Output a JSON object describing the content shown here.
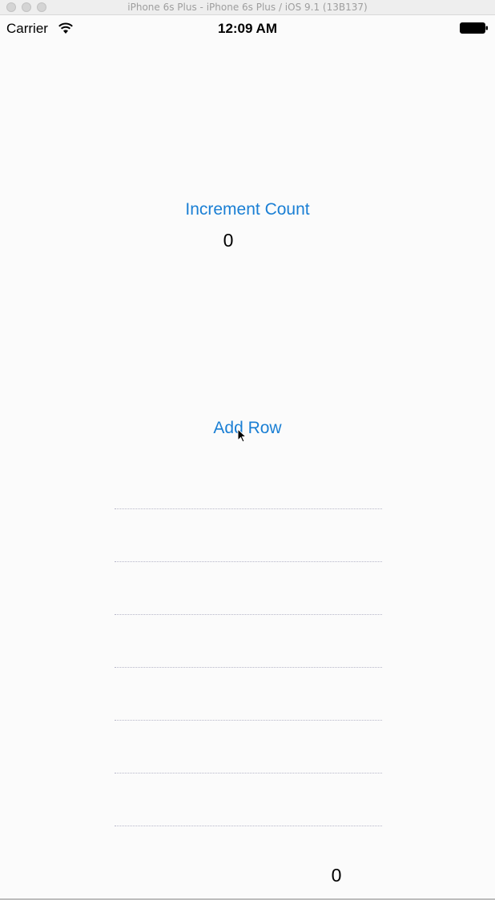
{
  "window": {
    "title": "iPhone 6s Plus - iPhone 6s Plus / iOS 9.1 (13B137)"
  },
  "status_bar": {
    "carrier": "Carrier",
    "time": "12:09 AM",
    "wifi_icon": "wifi-icon",
    "battery_icon": "battery-icon"
  },
  "main": {
    "increment_label": "Increment Count",
    "count_value": "0",
    "add_row_label": "Add Row",
    "bottom_count_value": "0"
  },
  "table": {
    "row_count": 7
  },
  "colors": {
    "button_tint": "#1a7fd4",
    "separator": "#b6b6c8",
    "background": "#fbfbfb"
  }
}
